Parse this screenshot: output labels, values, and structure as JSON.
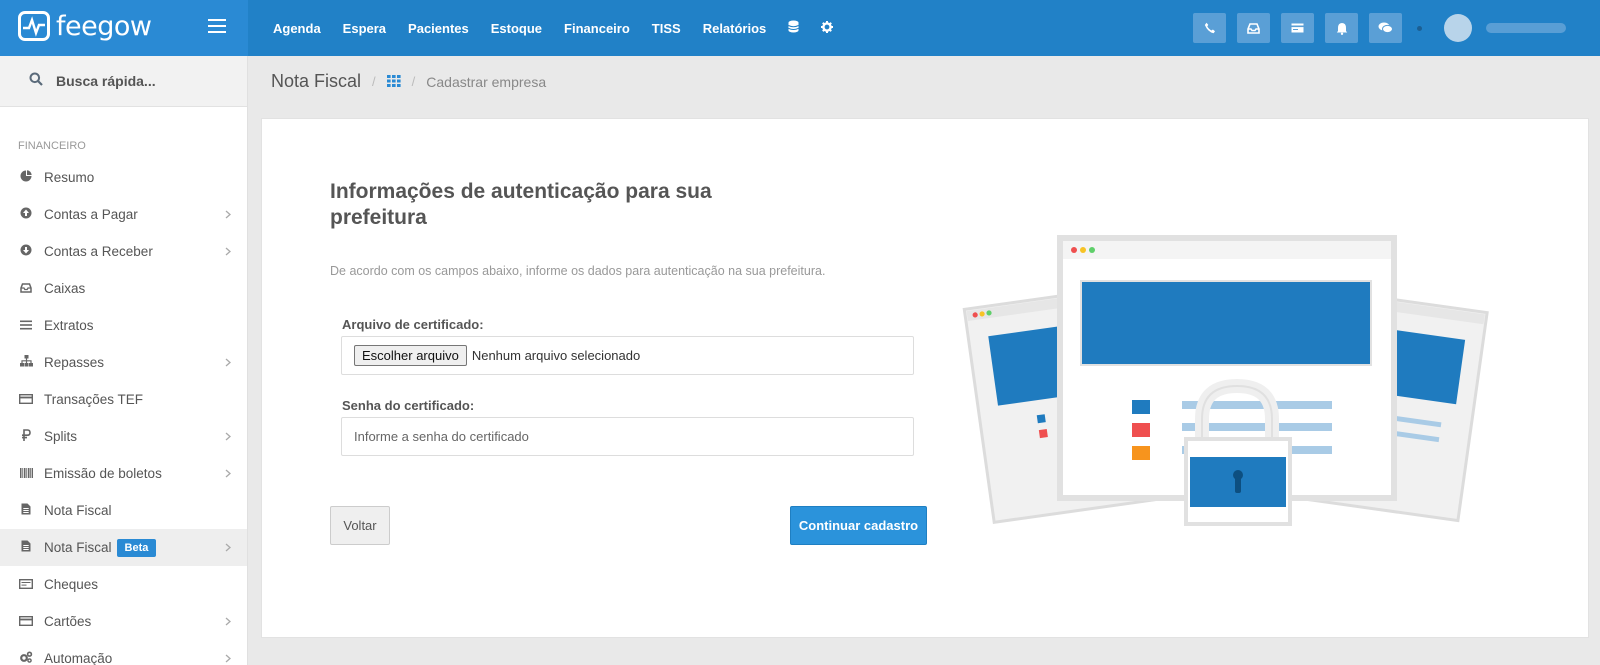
{
  "app": {
    "brand": "feegow"
  },
  "topnav": {
    "items": [
      "Agenda",
      "Espera",
      "Pacientes",
      "Estoque",
      "Financeiro",
      "TISS",
      "Relatórios"
    ],
    "icons": [
      "database-icon",
      "gear-icon"
    ]
  },
  "top_actions": [
    "phone-icon",
    "inbox-icon",
    "card-icon",
    "bell-icon",
    "chat-icon"
  ],
  "search": {
    "placeholder": "Busca rápida..."
  },
  "sidebar": {
    "section": "FINANCEIRO",
    "items": [
      {
        "label": "Resumo",
        "icon": "pie-chart-icon",
        "chevron": false
      },
      {
        "label": "Contas a Pagar",
        "icon": "arrow-up-circle-icon",
        "chevron": true
      },
      {
        "label": "Contas a Receber",
        "icon": "arrow-down-circle-icon",
        "chevron": true
      },
      {
        "label": "Caixas",
        "icon": "inbox-icon",
        "chevron": false
      },
      {
        "label": "Extratos",
        "icon": "list-icon",
        "chevron": false
      },
      {
        "label": "Repasses",
        "icon": "sitemap-icon",
        "chevron": true
      },
      {
        "label": "Transações TEF",
        "icon": "credit-card-icon",
        "chevron": false
      },
      {
        "label": "Splits",
        "icon": "ruble-icon",
        "chevron": true
      },
      {
        "label": "Emissão de boletos",
        "icon": "barcode-icon",
        "chevron": true
      },
      {
        "label": "Nota Fiscal",
        "icon": "file-icon",
        "chevron": false
      },
      {
        "label": "Nota Fiscal",
        "icon": "file-icon",
        "chevron": true,
        "badge": "Beta",
        "active": true
      },
      {
        "label": "Cheques",
        "icon": "cheque-icon",
        "chevron": false
      },
      {
        "label": "Cartões",
        "icon": "credit-card-icon",
        "chevron": true
      },
      {
        "label": "Automação",
        "icon": "cogs-icon",
        "chevron": true
      }
    ]
  },
  "breadcrumb": {
    "title": "Nota Fiscal",
    "current": "Cadastrar empresa"
  },
  "form": {
    "heading": "Informações de autenticação para sua prefeitura",
    "description": "De acordo com os campos abaixo, informe os dados para autenticação na sua prefeitura.",
    "cert_label": "Arquivo de certificado:",
    "file_button": "Escolher arquivo",
    "file_status": "Nenhum arquivo selecionado",
    "password_label": "Senha do certificado:",
    "password_placeholder": "Informe a senha do certificado",
    "back_label": "Voltar",
    "continue_label": "Continuar cadastro"
  },
  "colors": {
    "primary": "#2181c7",
    "button": "#2b93db",
    "illustration_blue": "#1f7bbf",
    "red": "#ef4f4f",
    "orange": "#f7941d"
  }
}
